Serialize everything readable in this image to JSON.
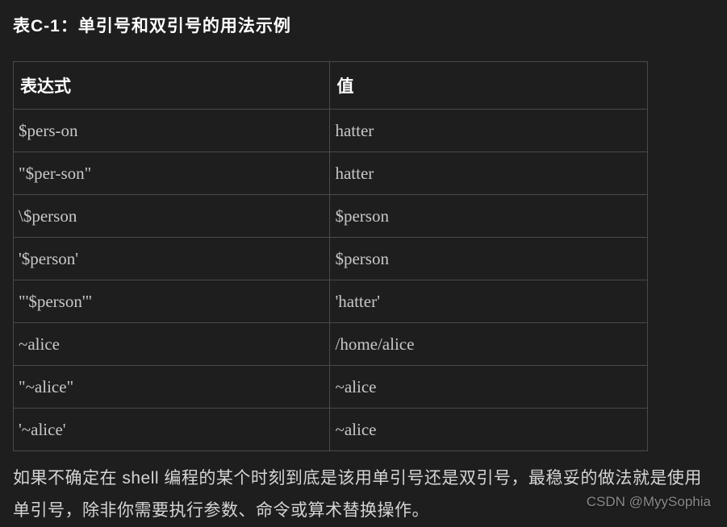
{
  "title": "表C-1：单引号和双引号的用法示例",
  "headers": {
    "expression": "表达式",
    "value": "值"
  },
  "rows": [
    {
      "expr": "$pers-on",
      "val": "hatter"
    },
    {
      "expr": "\"$per-son\"",
      "val": "hatter"
    },
    {
      "expr": "\\$person",
      "val": "$person"
    },
    {
      "expr": "'$person'",
      "val": "$person"
    },
    {
      "expr": "\"'$person'\"",
      "val": "'hatter'"
    },
    {
      "expr": "~alice",
      "val": "/home/alice"
    },
    {
      "expr": "\"~alice\"",
      "val": "~alice"
    },
    {
      "expr": "'~alice'",
      "val": "~alice"
    }
  ],
  "paragraph": "如果不确定在 shell 编程的某个时刻到底是该用单引号还是双引号，最稳妥的做法就是使用单引号，除非你需要执行参数、命令或算术替换操作。",
  "watermark": "CSDN @MyySophia"
}
